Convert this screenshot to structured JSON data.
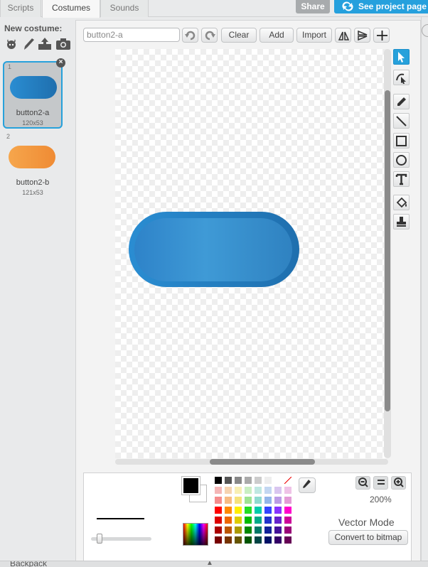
{
  "tabs": [
    {
      "label": "Scripts",
      "active": false
    },
    {
      "label": "Costumes",
      "active": true
    },
    {
      "label": "Sounds",
      "active": false
    }
  ],
  "header": {
    "share_label": "Share",
    "see_project_label": "See project page"
  },
  "new_costume": {
    "label": "New costume:",
    "icons": [
      "sprite-library-icon",
      "paint-brush-icon",
      "upload-icon",
      "camera-icon"
    ]
  },
  "costumes": [
    {
      "number": "1",
      "name": "button2-a",
      "size": "120x53",
      "color": "#2a88d0",
      "selected": true
    },
    {
      "number": "2",
      "name": "button2-b",
      "size": "121x53",
      "color": "#f39a3c",
      "selected": false
    }
  ],
  "editor": {
    "costume_name": "button2-a",
    "clear_label": "Clear",
    "add_label": "Add",
    "import_label": "Import",
    "zoom_level": "200%",
    "mode_label": "Vector Mode",
    "convert_label": "Convert to bitmap",
    "accent_color": "#27a1db",
    "sprite_colors": {
      "outer": "#2a8dd2",
      "inner": "#3f9ad6"
    }
  },
  "tools": [
    "select-icon",
    "reshape-icon",
    "pencil-icon",
    "line-icon",
    "rectangle-icon",
    "ellipse-icon",
    "text-icon",
    "fill-icon",
    "stamp-icon"
  ],
  "colors": {
    "primary": "#000000",
    "secondary": "#ffffff",
    "palette": [
      [
        "#000000",
        "#555555",
        "#888888",
        "#aaaaaa",
        "#cccccc",
        "#eeeeee",
        "#ffffff",
        "none"
      ],
      [
        "#f4b6b6",
        "#f6d3b0",
        "#f8efb3",
        "#c9efc2",
        "#bfe8e2",
        "#c3d7f2",
        "#d9c6f0",
        "#efc3e7"
      ],
      [
        "#f58c8c",
        "#f7bb83",
        "#f5e27c",
        "#9ee392",
        "#8fdbd0",
        "#93b6ea",
        "#bb9ce6",
        "#e39bd6"
      ],
      [
        "#ff0000",
        "#ff8800",
        "#ffee00",
        "#22dd22",
        "#00ccaa",
        "#3344ff",
        "#8833ff",
        "#ff00cc"
      ],
      [
        "#dd0000",
        "#ee6600",
        "#ddcc00",
        "#00bb00",
        "#00aa88",
        "#2233cc",
        "#6622cc",
        "#cc0099"
      ],
      [
        "#aa0000",
        "#bb5500",
        "#aa9900",
        "#008800",
        "#007766",
        "#112299",
        "#441199",
        "#990077"
      ],
      [
        "#770000",
        "#773300",
        "#665500",
        "#005500",
        "#004444",
        "#001166",
        "#330066",
        "#660055"
      ]
    ]
  },
  "backpack_label": "Backpack"
}
